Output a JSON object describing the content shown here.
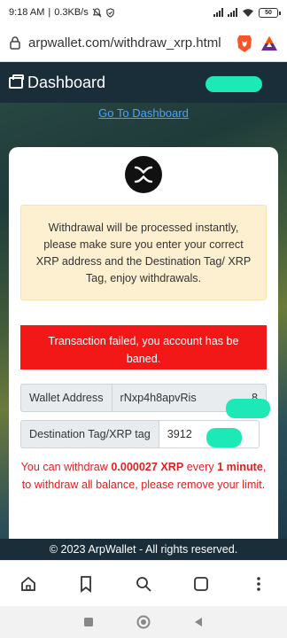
{
  "status_bar": {
    "time": "9:18 AM",
    "speed": "0.3KB/s",
    "battery": "50"
  },
  "url_bar": {
    "url": "arpwallet.com/withdraw_xrp.html"
  },
  "navbar": {
    "brand": "Dashboard"
  },
  "links": {
    "go_dashboard": "Go To Dashboard"
  },
  "card": {
    "notice": "Withdrawal will be processed instantly, please make sure you enter your correct XRP address and the Destination Tag/ XRP Tag, enjoy withdrawals.",
    "alert": "Transaction failed, you account has be baned.",
    "wallet_label": "Wallet Address",
    "wallet_value": "rNxp4h8apvRis",
    "wallet_tail": "8",
    "tag_label": "Destination Tag/XRP tag",
    "tag_value": "3912",
    "limit_prefix": "You can withdraw ",
    "limit_amount": "0.000027 XRP",
    "limit_mid": " every ",
    "limit_period": "1 minute",
    "limit_suffix": ", to withdraw all balance, please remove your limit."
  },
  "footer": {
    "text": "© 2023 ArpWallet - All rights reserved."
  },
  "colors": {
    "alert": "#f21818",
    "notice_bg": "#fdf0d0",
    "redaction": "#1de9b6",
    "navbar": "#1a2e3a"
  }
}
